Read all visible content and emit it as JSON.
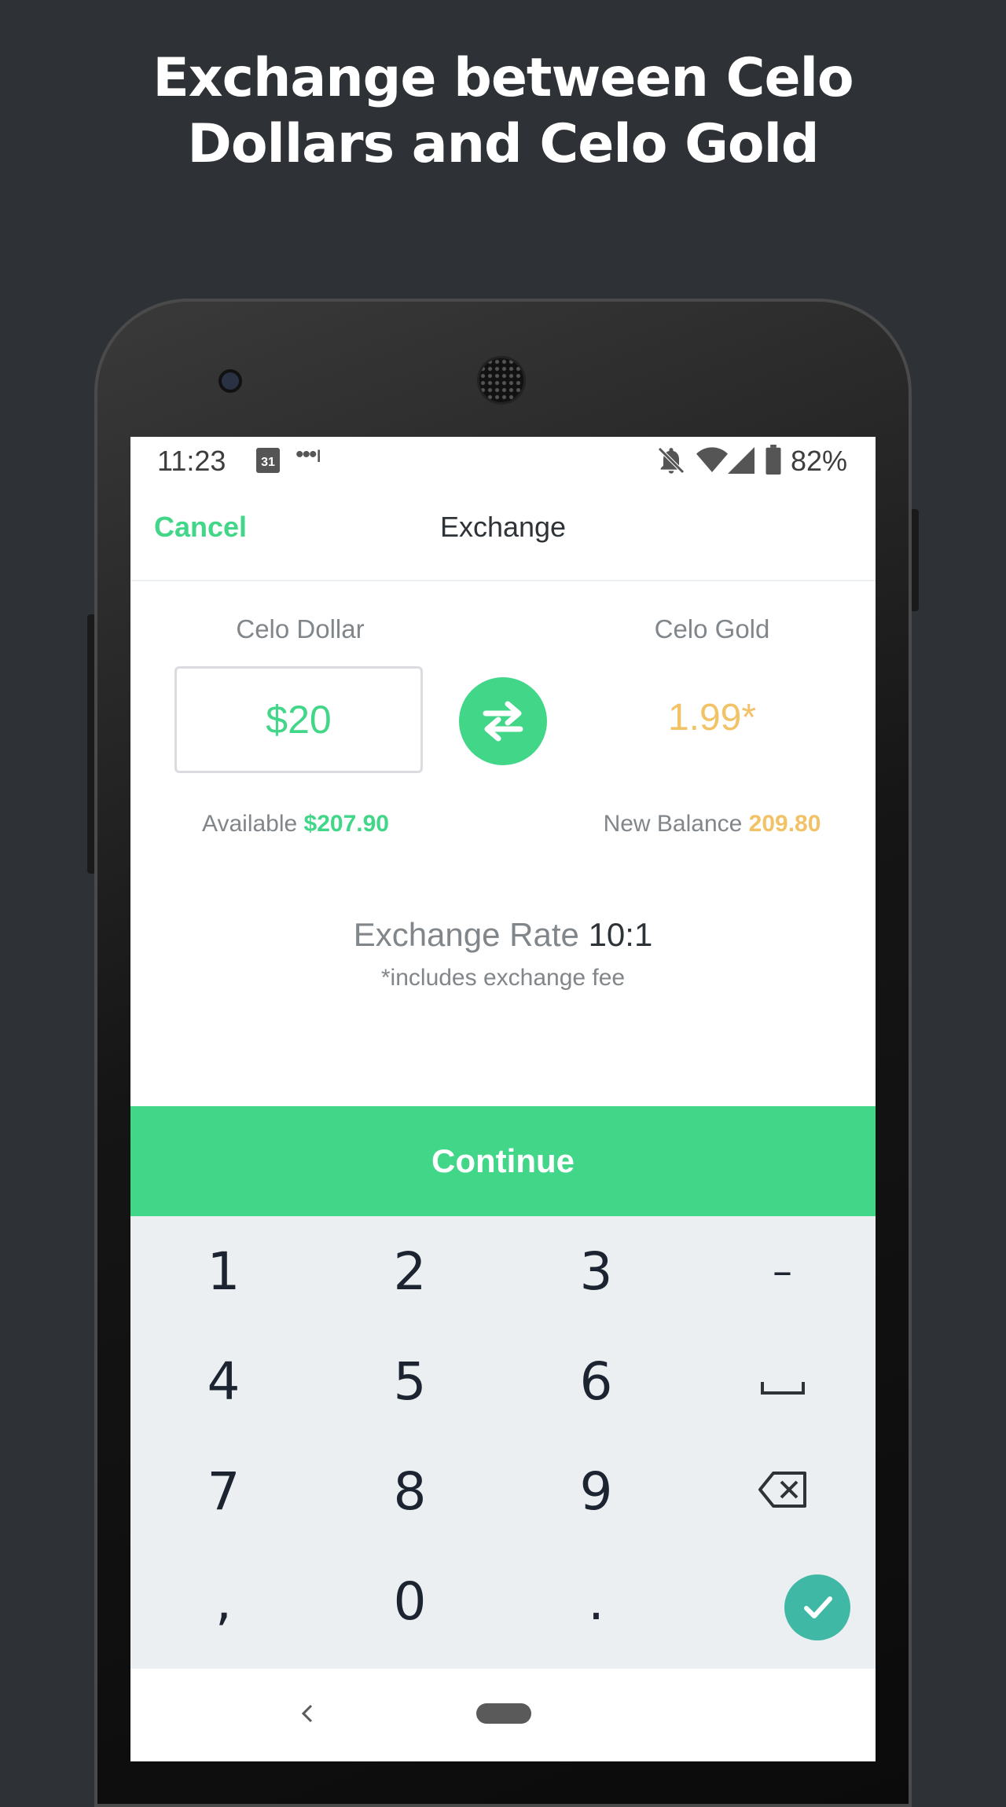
{
  "headline": [
    "Exchange between Celo",
    "Dollars and Celo Gold"
  ],
  "status_bar": {
    "time": "11:23",
    "calendar_day": "31",
    "battery": "82%"
  },
  "top_bar": {
    "cancel_label": "Cancel",
    "title": "Exchange"
  },
  "exchange": {
    "from_label": "Celo Dollar",
    "to_label": "Celo Gold",
    "amount_value": "$20",
    "converted_value": "1.99*",
    "available_label": "Available",
    "available_value": "$207.90",
    "new_balance_label": "New Balance",
    "new_balance_value": "209.80",
    "rate_label": "Exchange Rate",
    "rate_value": "10:1",
    "fee_note": "*includes exchange fee"
  },
  "continue_label": "Continue",
  "keypad": {
    "keys": [
      "1",
      "2",
      "3",
      "–",
      "4",
      "5",
      "6",
      "␣",
      "7",
      "8",
      "9",
      "⌫",
      ",",
      "0",
      ".",
      "✓"
    ]
  },
  "colors": {
    "accent_green": "#42d689",
    "gold": "#f2c267",
    "teal_check": "#3fb9a5",
    "background": "#2e3135",
    "keypad_bg": "#eceff1"
  },
  "icons": [
    "calendar-icon",
    "more-dots-icon",
    "bell-off-icon",
    "wifi-icon",
    "signal-icon",
    "battery-icon",
    "swap-arrows-icon",
    "backspace-icon",
    "space-icon",
    "check-icon",
    "back-nav-icon",
    "home-pill-icon"
  ]
}
